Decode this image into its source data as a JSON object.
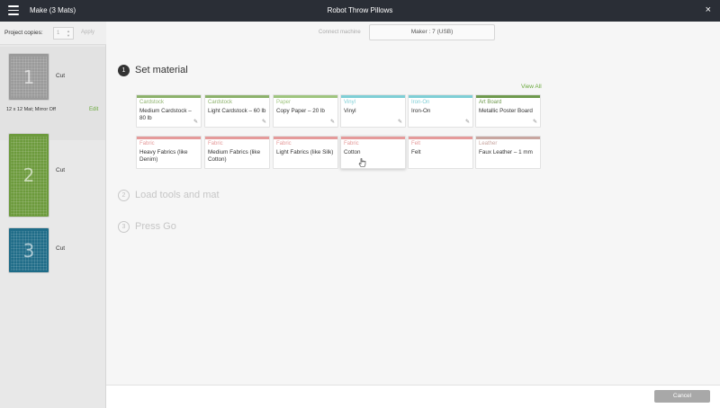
{
  "header": {
    "app_title": "Make (3 Mats)",
    "project_title": "Robot Throw Pillows",
    "close_symbol": "×"
  },
  "sidebar": {
    "copies_label": "Project copies:",
    "copies_value": "1",
    "apply_label": "Apply",
    "mats": [
      {
        "number": "1",
        "action": "Cut",
        "color": "#9a9a9a"
      },
      {
        "number": "2",
        "action": "Cut",
        "color": "#6c9a3c"
      },
      {
        "number": "3",
        "action": "Cut",
        "color": "#1f6c88"
      }
    ],
    "selected_mat_info": "12 x 12 Mat; Mirror Off",
    "edit_label": "Edit"
  },
  "main": {
    "connect_label": "Connect machine",
    "machine_label": "Maker : 7 (USB)",
    "steps": [
      {
        "number": "1",
        "label": "Set material"
      },
      {
        "number": "2",
        "label": "Load tools and mat"
      },
      {
        "number": "3",
        "label": "Press Go"
      }
    ],
    "view_all_label": "View All",
    "materials_row1": [
      {
        "category": "Cardstock",
        "name": "Medium Cardstock – 80 lb",
        "color": "#8db26c"
      },
      {
        "category": "Cardstock",
        "name": "Light Cardstock – 60 lb",
        "color": "#8db26c"
      },
      {
        "category": "Paper",
        "name": "Copy Paper – 20 lb",
        "color": "#9fc57f"
      },
      {
        "category": "Vinyl",
        "name": "Vinyl",
        "color": "#7fcfd6"
      },
      {
        "category": "Iron-On",
        "name": "Iron-On",
        "color": "#7fcfd6"
      },
      {
        "category": "Art Board",
        "name": "Metallic Poster Board",
        "color": "#6f9a4e"
      }
    ],
    "materials_row2": [
      {
        "category": "Fabric",
        "name": "Heavy Fabrics (like Denim)",
        "color": "#e59a9a"
      },
      {
        "category": "Fabric",
        "name": "Medium Fabrics (like Cotton)",
        "color": "#e59a9a"
      },
      {
        "category": "Fabric",
        "name": "Light Fabrics (like Silk)",
        "color": "#e59a9a"
      },
      {
        "category": "Fabric",
        "name": "Cotton",
        "color": "#e59a9a"
      },
      {
        "category": "Felt",
        "name": "Felt",
        "color": "#e59a9a"
      },
      {
        "category": "Leather",
        "name": "Faux Leather – 1 mm",
        "color": "#c8a6a0"
      }
    ]
  },
  "footer": {
    "cancel_label": "Cancel"
  }
}
